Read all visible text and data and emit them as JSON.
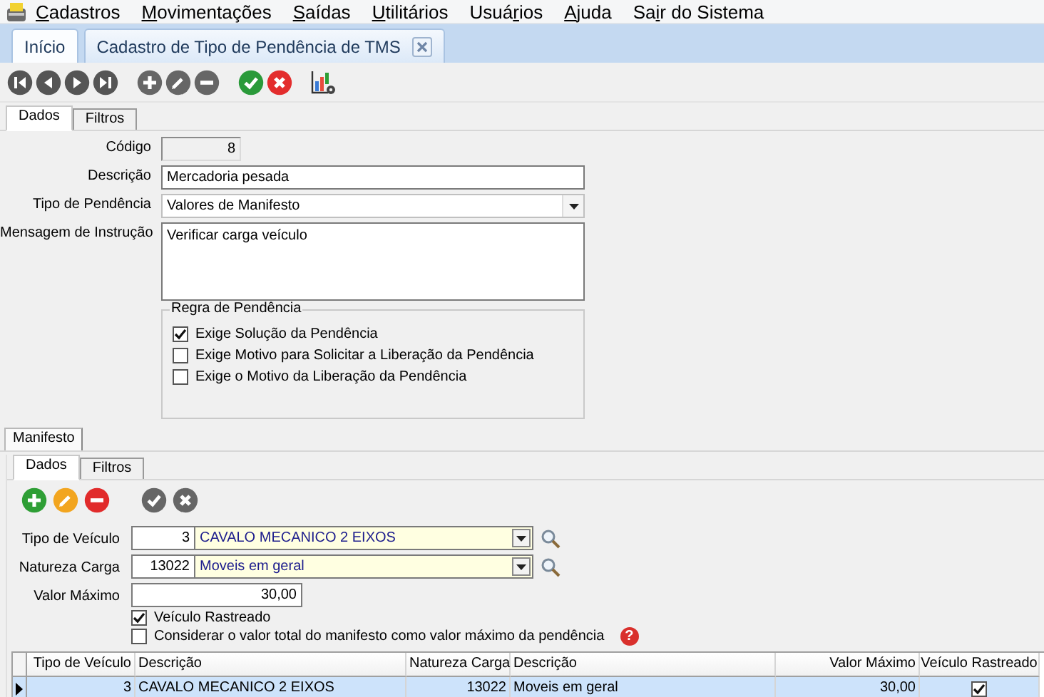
{
  "menu": [
    {
      "key": "C",
      "post": "adastros"
    },
    {
      "key": "M",
      "post": "ovimentações"
    },
    {
      "key": "S",
      "post": "aídas"
    },
    {
      "key": "U",
      "post": "tilitários"
    },
    {
      "pre": "Usuá",
      "key": "r",
      "post": "ios"
    },
    {
      "key": "A",
      "post": "juda"
    },
    {
      "pre": "Sa",
      "key": "i",
      "post": "r do Sistema"
    }
  ],
  "tabs": [
    {
      "label": "Início",
      "selected": false,
      "closable": false
    },
    {
      "label": "Cadastro de Tipo de Pendência de TMS",
      "selected": true,
      "closable": true
    }
  ],
  "toolbar": [
    {
      "kind": "first"
    },
    {
      "kind": "prev"
    },
    {
      "kind": "next"
    },
    {
      "kind": "last"
    },
    {
      "kind": "sep"
    },
    {
      "kind": "add",
      "enabled": false
    },
    {
      "kind": "edit",
      "enabled": false
    },
    {
      "kind": "delete",
      "enabled": false
    },
    {
      "kind": "sep"
    },
    {
      "kind": "save",
      "enabled": true
    },
    {
      "kind": "cancel",
      "enabled": true
    },
    {
      "kind": "sep"
    },
    {
      "kind": "report"
    }
  ],
  "subtabs": [
    {
      "label": "Dados",
      "selected": true
    },
    {
      "label": "Filtros",
      "selected": false
    }
  ],
  "form": {
    "codigo": {
      "label": "Código",
      "value": "8"
    },
    "descricao": {
      "label": "Descrição",
      "value": "Mercadoria pesada"
    },
    "tipo_pendencia": {
      "label": "Tipo de Pendência",
      "value": "Valores de Manifesto"
    },
    "mensagem": {
      "label": "Mensagem de Instrução",
      "value": "Verificar carga veículo"
    },
    "regra": {
      "title": "Regra de Pendência",
      "options": [
        {
          "label": "Exige Solução da Pendência",
          "checked": true
        },
        {
          "label": "Exige Motivo para Solicitar a Liberação da Pendência",
          "checked": false
        },
        {
          "label": "Exige o Motivo da Liberação da Pendência",
          "checked": false
        }
      ]
    }
  },
  "manifesto": {
    "tab": {
      "label": "Manifesto",
      "selected": true
    },
    "subtabs": [
      {
        "label": "Dados",
        "selected": true
      },
      {
        "label": "Filtros",
        "selected": false
      }
    ],
    "toolbar": [
      {
        "kind": "add",
        "enabled": true
      },
      {
        "kind": "edit",
        "enabled": true
      },
      {
        "kind": "delete",
        "enabled": true
      },
      {
        "kind": "sep"
      },
      {
        "kind": "save",
        "enabled": false
      },
      {
        "kind": "cancel",
        "enabled": false
      }
    ],
    "lookups": [
      {
        "label": "Tipo de Veículo",
        "code": "3",
        "value": "CAVALO MECANICO 2 EIXOS"
      },
      {
        "label": "Natureza Carga",
        "code": "13022",
        "value": "Moveis em geral"
      }
    ],
    "valor_maximo": {
      "label": "Valor Máximo",
      "value": "30,00"
    },
    "options": [
      {
        "label": "Veículo Rastreado",
        "checked": true
      },
      {
        "label": "Considerar o valor total do manifesto como valor máximo da pendência",
        "checked": false,
        "help": "?"
      }
    ],
    "grid": {
      "columns": [
        "Tipo de Veículo",
        "Descrição",
        "Natureza Carga",
        "Descrição",
        "Valor Máximo",
        "Veículo Rastreado"
      ],
      "rows": [
        {
          "selected": true,
          "tipo": "3",
          "descricao": "CAVALO MECANICO 2 EIXOS",
          "natureza": "13022",
          "natureza_descricao": "Moveis em geral",
          "valor": "30,00",
          "rastreado": true
        }
      ]
    }
  }
}
